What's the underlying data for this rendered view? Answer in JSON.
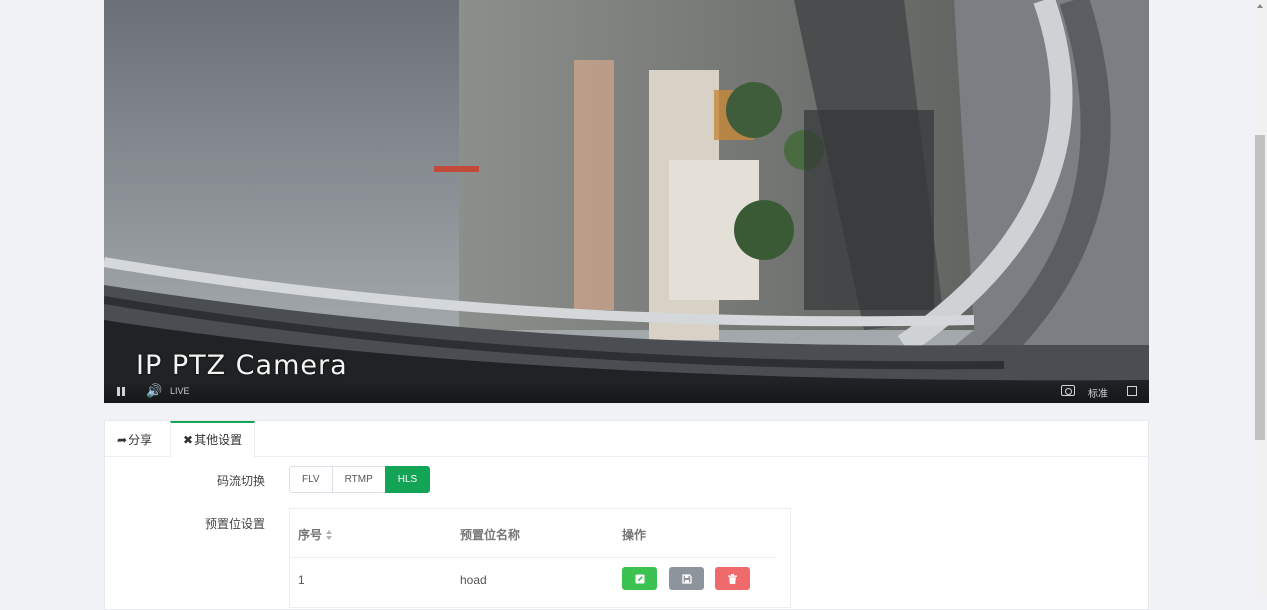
{
  "player": {
    "osd_text": "IP PTZ Camera",
    "live_label": "LIVE",
    "quality_label": "标准",
    "controls": [
      "pause-icon",
      "volume-icon",
      "camera-icon",
      "fullscreen-icon"
    ]
  },
  "tabs": [
    {
      "label": "分享",
      "icon": "share-icon",
      "active": false
    },
    {
      "label": "其他设置",
      "icon": "expand-icon",
      "active": true
    }
  ],
  "stream": {
    "label": "码流切换",
    "options": [
      "FLV",
      "RTMP",
      "HLS"
    ],
    "selected": "HLS"
  },
  "preset": {
    "label": "预置位设置",
    "columns": [
      "序号",
      "预置位名称",
      "操作"
    ],
    "rows": [
      {
        "index": "1",
        "name": "hoad",
        "actions": [
          "edit-icon",
          "save-icon",
          "delete-icon"
        ]
      }
    ]
  },
  "colors": {
    "accent": "#13a455",
    "edit": "#3cc251",
    "save": "#8e949c",
    "delete": "#ef6b6b"
  }
}
